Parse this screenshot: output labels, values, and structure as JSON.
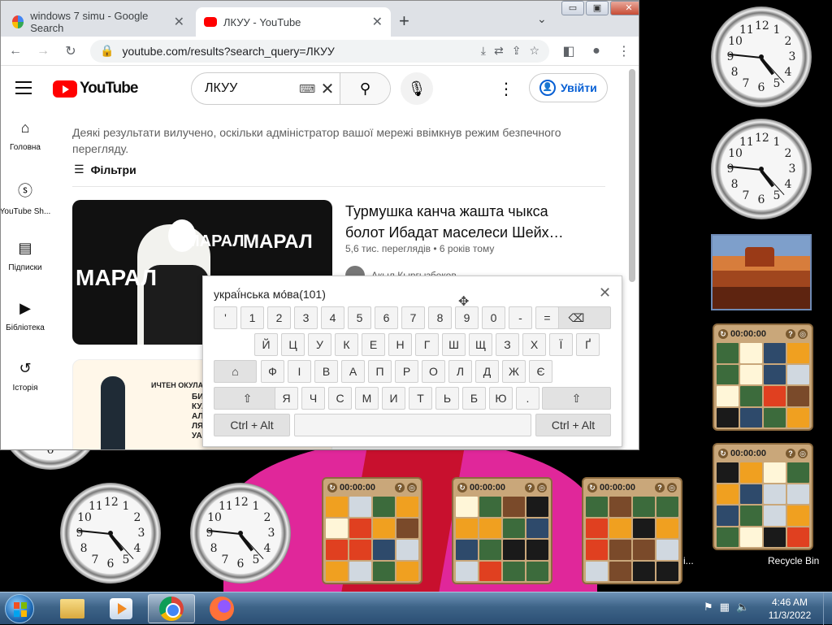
{
  "browser": {
    "tabs": [
      {
        "title": "windows 7 simu - Google Search",
        "favicon": "google-icon"
      },
      {
        "title": "ЛКУУ - YouTube",
        "favicon": "youtube-icon"
      }
    ],
    "new_tab": "+",
    "window_controls": {
      "minimize": "▭",
      "maximize": "▣",
      "close": "✕"
    },
    "url": "youtube.com/results?search_query=ЛКУУ"
  },
  "youtube": {
    "logo_text": "YouTube",
    "search_query": "ЛКУУ",
    "sign_in": "Увійти",
    "sidebar": [
      {
        "label": "Головна",
        "icon": "home-icon"
      },
      {
        "label": "YouTube Sh...",
        "icon": "shorts-icon"
      },
      {
        "label": "Підписки",
        "icon": "subscriptions-icon"
      },
      {
        "label": "Бібліотека",
        "icon": "library-icon"
      },
      {
        "label": "Історія",
        "icon": "history-icon"
      }
    ],
    "notice": "Деякі результати вилучено, оскільки адміністратор вашої мережі ввімкнув режим безпечного перегляду.",
    "filters_label": "Фільтри",
    "video1": {
      "title": "Турмушка канча жашта чыкса болот Ибадат маселеси Шейх…",
      "meta": "5,6 тис. переглядів • 6 років тому",
      "channel": "Акыл Кыргызбеков",
      "thumb_text_a": "МАРАЛ",
      "thumb_text_b": "МАРАЛ",
      "thumb_text_c": "МАРАЛ"
    },
    "video2": {
      "thumb_brand": "ИЧТЕН ОКУЛАТ",
      "thumb_lines": "БИС\nКУЛ\nАЛ\nЛЯМ\nУА АЛ"
    }
  },
  "keyboard": {
    "title": "украї́нська мо́ва(101)",
    "row1": [
      "'",
      "1",
      "2",
      "3",
      "4",
      "5",
      "6",
      "7",
      "8",
      "9",
      "0",
      "-",
      "="
    ],
    "row2": [
      "Й",
      "Ц",
      "У",
      "К",
      "Е",
      "Н",
      "Г",
      "Ш",
      "Щ",
      "З",
      "Х",
      "Ї",
      "Ґ"
    ],
    "row3": [
      "Ф",
      "І",
      "В",
      "А",
      "П",
      "Р",
      "О",
      "Л",
      "Д",
      "Ж",
      "Є"
    ],
    "row4": [
      "Я",
      "Ч",
      "С",
      "М",
      "И",
      "Т",
      "Ь",
      "Б",
      "Ю",
      "."
    ],
    "ctrl_alt_left": "Ctrl + Alt",
    "ctrl_alt_right": "Ctrl + Alt",
    "backspace": "⌫",
    "shift": "⇧",
    "home": "⌂"
  },
  "desktop": {
    "puzzle_timer": "00:00:00",
    "recycle_bin": "Recycle Bin",
    "truncated_label": "i..."
  },
  "taskbar": {
    "time": "4:46 AM",
    "date": "11/3/2022"
  }
}
